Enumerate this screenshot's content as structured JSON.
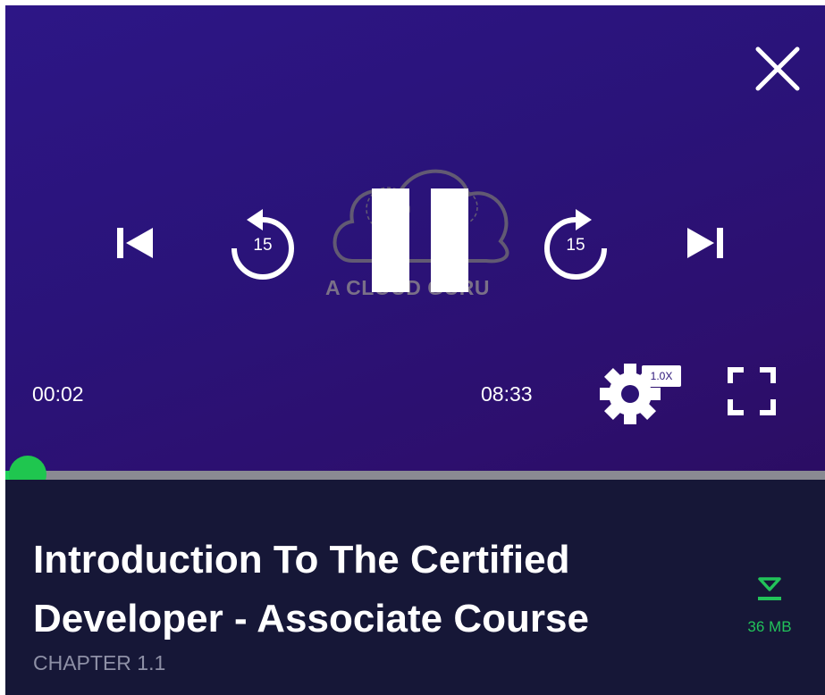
{
  "player": {
    "current_time": "00:02",
    "duration": "08:33",
    "speed": "1.0X",
    "progress": 0.004,
    "skip_seconds": "15",
    "watermark": "A CLOUD GURU",
    "accent_color": "#1fc64f",
    "icons": [
      "close-icon",
      "skip-previous-icon",
      "rewind-15-icon",
      "pause-icon",
      "forward-15-icon",
      "skip-next-icon",
      "settings-gear-icon",
      "fullscreen-icon",
      "download-icon"
    ]
  },
  "lesson": {
    "title": "Introduction To The Certified Developer - Associate Course",
    "chapter": "CHAPTER 1.1",
    "download_size": "36 MB"
  }
}
